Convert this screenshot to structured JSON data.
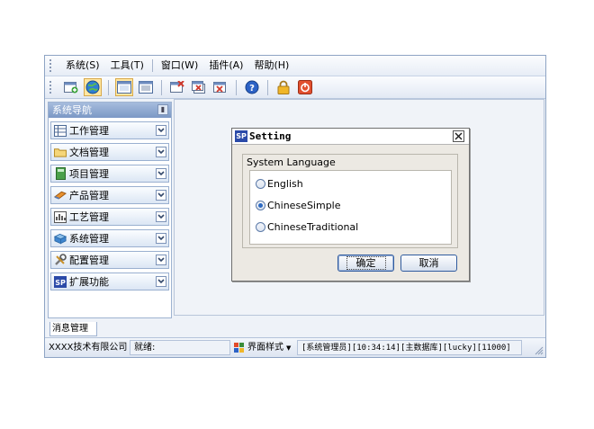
{
  "menubar": {
    "items": [
      "系统(S)",
      "工具(T)",
      "窗口(W)",
      "插件(A)",
      "帮助(H)"
    ]
  },
  "toolbar": {
    "icons": [
      "add-window-icon",
      "globe-icon",
      "window-icon",
      "window-list-icon",
      "close-window-icon",
      "close-all-icon",
      "close-other-icon",
      "help-icon",
      "lock-icon",
      "exit-icon"
    ]
  },
  "sidebar": {
    "title": "系统导航",
    "items": [
      {
        "label": "工作管理",
        "icon": "work-icon"
      },
      {
        "label": "文档管理",
        "icon": "folder-icon"
      },
      {
        "label": "项目管理",
        "icon": "book-icon"
      },
      {
        "label": "产品管理",
        "icon": "product-icon"
      },
      {
        "label": "工艺管理",
        "icon": "process-icon"
      },
      {
        "label": "系统管理",
        "icon": "system-icon"
      },
      {
        "label": "配置管理",
        "icon": "tools-icon"
      },
      {
        "label": "扩展功能",
        "icon": "sp-logo-icon"
      }
    ]
  },
  "bottom_tab": {
    "label": "消息管理"
  },
  "statusbar": {
    "company": "XXXX技术有限公司",
    "status": "就绪:",
    "theme_label": "界面样式",
    "info": "[系统管理员][10:34:14][主数据库][lucky][11000]"
  },
  "dialog": {
    "logo": "SP",
    "title": "Setting",
    "group_label": "System Language",
    "options": [
      "English",
      "ChineseSimple",
      "ChineseTraditional"
    ],
    "selected": "ChineseSimple",
    "ok_label": "确定",
    "cancel_label": "取消"
  },
  "colors": {
    "accent": "#2d6ac2",
    "sidebar_header": "#7b98c5",
    "frame": "#8ea4c4"
  }
}
